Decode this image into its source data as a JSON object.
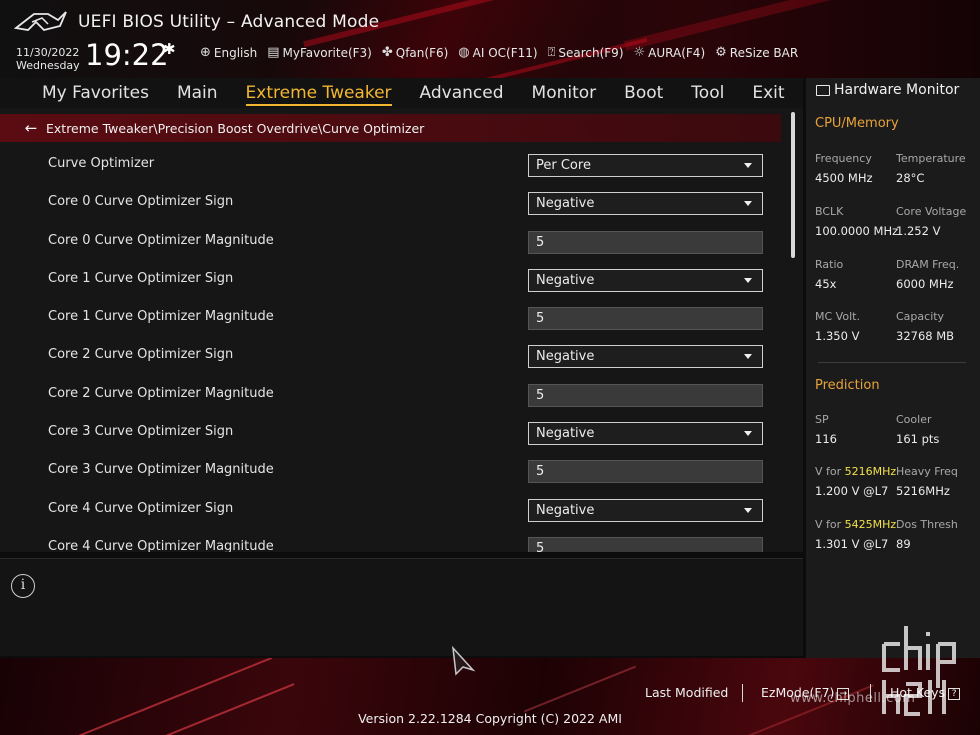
{
  "header": {
    "title": "UEFI BIOS Utility – Advanced Mode",
    "date": "11/30/2022",
    "weekday": "Wednesday",
    "time": "19:22",
    "toolbar": [
      {
        "name": "language",
        "icon": "globe-icon",
        "label": "English"
      },
      {
        "name": "myfavorite",
        "icon": "favorite-icon",
        "label": "MyFavorite(F3)"
      },
      {
        "name": "qfan",
        "icon": "fan-icon",
        "label": "Qfan(F6)"
      },
      {
        "name": "ai-oc",
        "icon": "ai-icon",
        "label": "AI OC(F11)"
      },
      {
        "name": "search",
        "icon": "help-search-icon",
        "label": "Search(F9)"
      },
      {
        "name": "aura",
        "icon": "aura-icon",
        "label": "AURA(F4)"
      },
      {
        "name": "resize-bar",
        "icon": "resize-bar-icon",
        "label": "ReSize BAR"
      }
    ]
  },
  "tabs": [
    {
      "label": "My Favorites",
      "active": false
    },
    {
      "label": "Main",
      "active": false
    },
    {
      "label": "Extreme Tweaker",
      "active": true
    },
    {
      "label": "Advanced",
      "active": false
    },
    {
      "label": "Monitor",
      "active": false
    },
    {
      "label": "Boot",
      "active": false
    },
    {
      "label": "Tool",
      "active": false
    },
    {
      "label": "Exit",
      "active": false
    }
  ],
  "breadcrumb": "Extreme Tweaker\\Precision Boost Overdrive\\Curve Optimizer",
  "settings": [
    {
      "label": "Curve Optimizer",
      "type": "select",
      "value": "Per Core"
    },
    {
      "label": "Core 0 Curve Optimizer Sign",
      "type": "select",
      "value": "Negative"
    },
    {
      "label": "Core 0 Curve Optimizer Magnitude",
      "type": "number",
      "value": "5"
    },
    {
      "label": "Core 1 Curve Optimizer Sign",
      "type": "select",
      "value": "Negative"
    },
    {
      "label": "Core 1 Curve Optimizer Magnitude",
      "type": "number",
      "value": "5"
    },
    {
      "label": "Core 2 Curve Optimizer Sign",
      "type": "select",
      "value": "Negative"
    },
    {
      "label": "Core 2 Curve Optimizer Magnitude",
      "type": "number",
      "value": "5"
    },
    {
      "label": "Core 3 Curve Optimizer Sign",
      "type": "select",
      "value": "Negative"
    },
    {
      "label": "Core 3 Curve Optimizer Magnitude",
      "type": "number",
      "value": "5"
    },
    {
      "label": "Core 4 Curve Optimizer Sign",
      "type": "select",
      "value": "Negative"
    },
    {
      "label": "Core 4 Curve Optimizer Magnitude",
      "type": "number",
      "value": "5"
    }
  ],
  "hardware_monitor": {
    "title": "Hardware Monitor",
    "cpu_memory": {
      "heading": "CPU/Memory",
      "frequency_label": "Frequency",
      "frequency": "4500 MHz",
      "temperature_label": "Temperature",
      "temperature": "28°C",
      "bclk_label": "BCLK",
      "bclk": "100.0000 MHz",
      "core_voltage_label": "Core Voltage",
      "core_voltage": "1.252 V",
      "ratio_label": "Ratio",
      "ratio": "45x",
      "dram_freq_label": "DRAM Freq.",
      "dram_freq": "6000 MHz",
      "mc_volt_label": "MC Volt.",
      "mc_volt": "1.350 V",
      "capacity_label": "Capacity",
      "capacity": "32768 MB"
    },
    "prediction": {
      "heading": "Prediction",
      "sp_label": "SP",
      "sp": "116",
      "cooler_label": "Cooler",
      "cooler": "161 pts",
      "v_for_label": "V for",
      "v_for_1_freq": "5216MHz",
      "v_for_1": "1.200 V @L7",
      "heavy_freq_label": "Heavy Freq",
      "heavy_freq": "5216MHz",
      "v_for_2_freq": "5425MHz",
      "v_for_2": "1.301 V @L7",
      "dos_thresh_label": "Dos Thresh",
      "dos_thresh": "89"
    }
  },
  "footer": {
    "last_modified": "Last Modified",
    "ezmode": "EzMode(F7)",
    "hot_keys": "Hot Keys",
    "version": "Version 2.22.1284 Copyright (C) 2022 AMI"
  },
  "watermark": "www.chiphell.com",
  "colors": {
    "accent": "#f2b731",
    "section_heading": "#e8a33a",
    "breadcrumb_bg": "#5a0c12",
    "highlight_freq": "#f2e14a"
  }
}
